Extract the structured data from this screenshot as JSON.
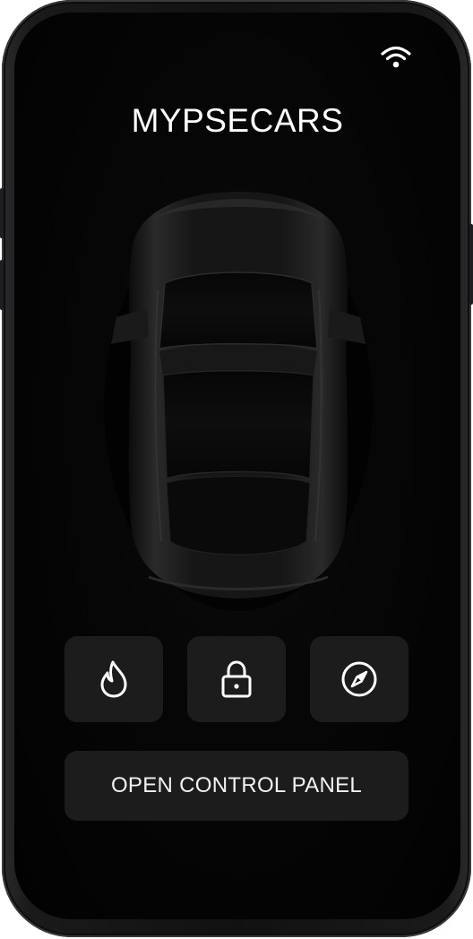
{
  "app": {
    "title": "MYPSECARS"
  },
  "status_bar": {
    "wifi_icon": "wifi-icon"
  },
  "quick_actions": [
    {
      "icon": "flame-icon",
      "name": "heating"
    },
    {
      "icon": "lock-icon",
      "name": "lock"
    },
    {
      "icon": "compass-icon",
      "name": "navigation"
    }
  ],
  "primary_action": {
    "label": "OPEN CONTROL PANEL"
  },
  "colors": {
    "background": "#050505",
    "button": "#1c1c1c",
    "text": "#ffffff"
  }
}
